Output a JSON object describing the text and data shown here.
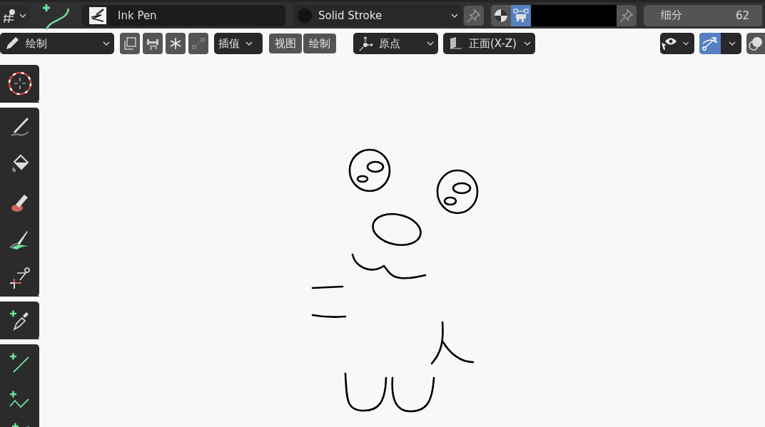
{
  "header": {
    "brush_name": "Ink Pen",
    "material": "Solid Stroke",
    "color_modes": [
      {
        "kind": "material",
        "selected": false
      },
      {
        "kind": "vertex",
        "selected": true
      }
    ],
    "subdivision": {
      "label": "细分",
      "value": "62"
    }
  },
  "tool_header": {
    "mode": "绘制",
    "interpolate": "插值",
    "menus": [
      "视图",
      "绘制"
    ],
    "pivot": "原点",
    "view": "正面(X-Z)",
    "toggles": [
      {
        "kind": "visibility",
        "selected": false
      },
      {
        "kind": "snap",
        "selected": true
      }
    ]
  }
}
